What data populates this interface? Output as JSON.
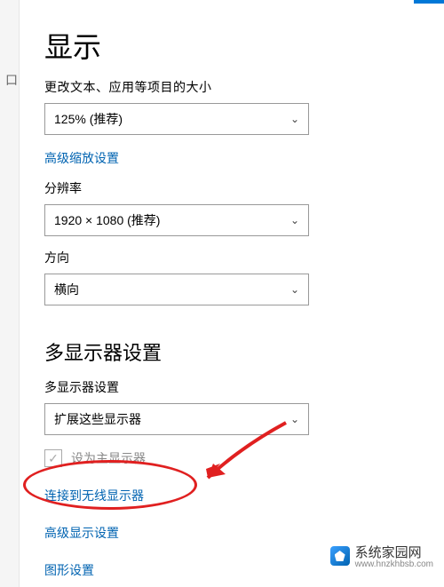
{
  "page": {
    "title": "显示",
    "scaling": {
      "label": "更改文本、应用等项目的大小",
      "value": "125% (推荐)",
      "advanced_link": "高级缩放设置"
    },
    "resolution": {
      "label": "分辨率",
      "value": "1920 × 1080 (推荐)"
    },
    "orientation": {
      "label": "方向",
      "value": "横向"
    },
    "multi": {
      "title": "多显示器设置",
      "label": "多显示器设置",
      "value": "扩展这些显示器",
      "primary_checkbox": "设为主显示器"
    },
    "links": {
      "wireless": "连接到无线显示器",
      "advanced_display": "高级显示设置",
      "graphics": "图形设置"
    }
  },
  "watermark": {
    "name": "系统家园网",
    "url": "www.hnzkhbsb.com"
  }
}
